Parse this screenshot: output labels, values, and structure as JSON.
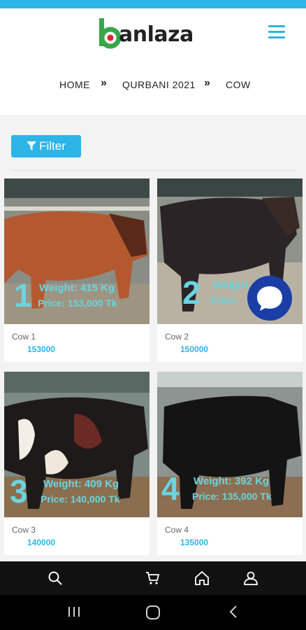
{
  "brand": {
    "logo_text": "anlaza",
    "accent_color": "#2cb5e6",
    "logo_green": "#3aa64a",
    "logo_red": "#e2232a"
  },
  "header": {
    "menu_icon": "hamburger-menu-icon"
  },
  "breadcrumb": {
    "items": [
      "HOME",
      "QURBANI 2021",
      "COW"
    ],
    "separator_icon": "double-chevron-right-icon"
  },
  "filter": {
    "label": "Filter",
    "icon": "filter-funnel-icon"
  },
  "products": [
    {
      "name": "Cow 1",
      "price": "153000",
      "overlay_number": "1",
      "overlay_weight": "Weight: 415 Kg",
      "overlay_price": "Price: 153,000 Tk"
    },
    {
      "name": "Cow 2",
      "price": "150000",
      "overlay_number": "2",
      "overlay_weight": "Weight",
      "overlay_price": "Price:"
    },
    {
      "name": "Cow 3",
      "price": "140000",
      "overlay_number": "3",
      "overlay_weight": "Weight: 409 Kg",
      "overlay_price": "Price: 140,000 Tk"
    },
    {
      "name": "Cow 4",
      "price": "135000",
      "overlay_number": "4",
      "overlay_weight": "Weight: 392 Kg",
      "overlay_price": "Price: 135,000 Tk"
    }
  ],
  "chat": {
    "icon": "chat-bubble-icon"
  },
  "bottom_nav": {
    "items": [
      "search-icon",
      "cart-icon",
      "home-icon",
      "user-icon"
    ]
  },
  "system_nav": {
    "items": [
      "recent-apps-icon",
      "home-circle-icon",
      "back-icon"
    ]
  }
}
